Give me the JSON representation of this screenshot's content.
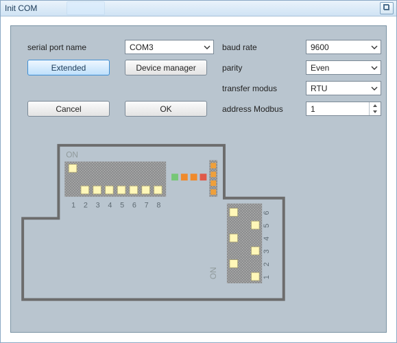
{
  "window": {
    "title": "Init COM"
  },
  "labels": {
    "serial_port_name": "serial port name",
    "baud_rate": "baud rate",
    "parity": "parity",
    "transfer_modus": "transfer modus",
    "address_modbus": "address Modbus"
  },
  "buttons": {
    "extended": "Extended",
    "device_manager": "Device manager",
    "cancel": "Cancel",
    "ok": "OK"
  },
  "values": {
    "port": "COM3",
    "baud": "9600",
    "parity": "Even",
    "modus": "RTU",
    "address": "1"
  },
  "dip": {
    "on_label": "ON",
    "h_switch_count": 8,
    "h_switch_up": [
      1
    ],
    "h_numbers": [
      "1",
      "2",
      "3",
      "4",
      "5",
      "6",
      "7",
      "8"
    ],
    "leds": [
      "#77c777",
      "#f08a2b",
      "#f08a2b",
      "#e05a4a"
    ],
    "vbar_leds": [
      "#f0a03a",
      "#f0a03a",
      "#f0a03a",
      "#f0a03a"
    ],
    "v_switch_count": 6,
    "v_switch_right": [
      1,
      3,
      5
    ],
    "v_numbers": [
      "1",
      "2",
      "3",
      "4",
      "5",
      "6"
    ]
  }
}
